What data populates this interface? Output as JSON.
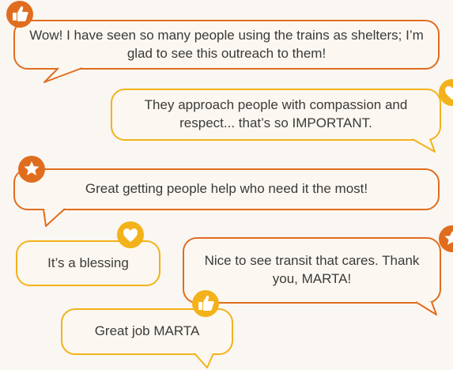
{
  "colors": {
    "orange": "#e06d1f",
    "yellow": "#f3b21b",
    "background": "#faf6f1",
    "bubble_fill": "#fcf8f1",
    "text": "#3a3a3a"
  },
  "comments": [
    {
      "text": "Wow! I have seen so many people using the trains as shelters; I’m glad to see this outreach to them!",
      "reaction": "thumbs-up-icon",
      "color": "orange"
    },
    {
      "text": "They approach people with compassion and respect... that’s so IMPORTANT.",
      "reaction": "heart-icon",
      "color": "yellow"
    },
    {
      "text": "Great getting people help who need it the most!",
      "reaction": "star-icon",
      "color": "orange"
    },
    {
      "text": "It’s a blessing",
      "reaction": "heart-icon",
      "color": "yellow"
    },
    {
      "text": "Nice to see transit that cares. Thank you, MARTA!",
      "reaction": "star-icon",
      "color": "orange"
    },
    {
      "text": "Great job MARTA",
      "reaction": "thumbs-up-icon",
      "color": "yellow"
    }
  ]
}
